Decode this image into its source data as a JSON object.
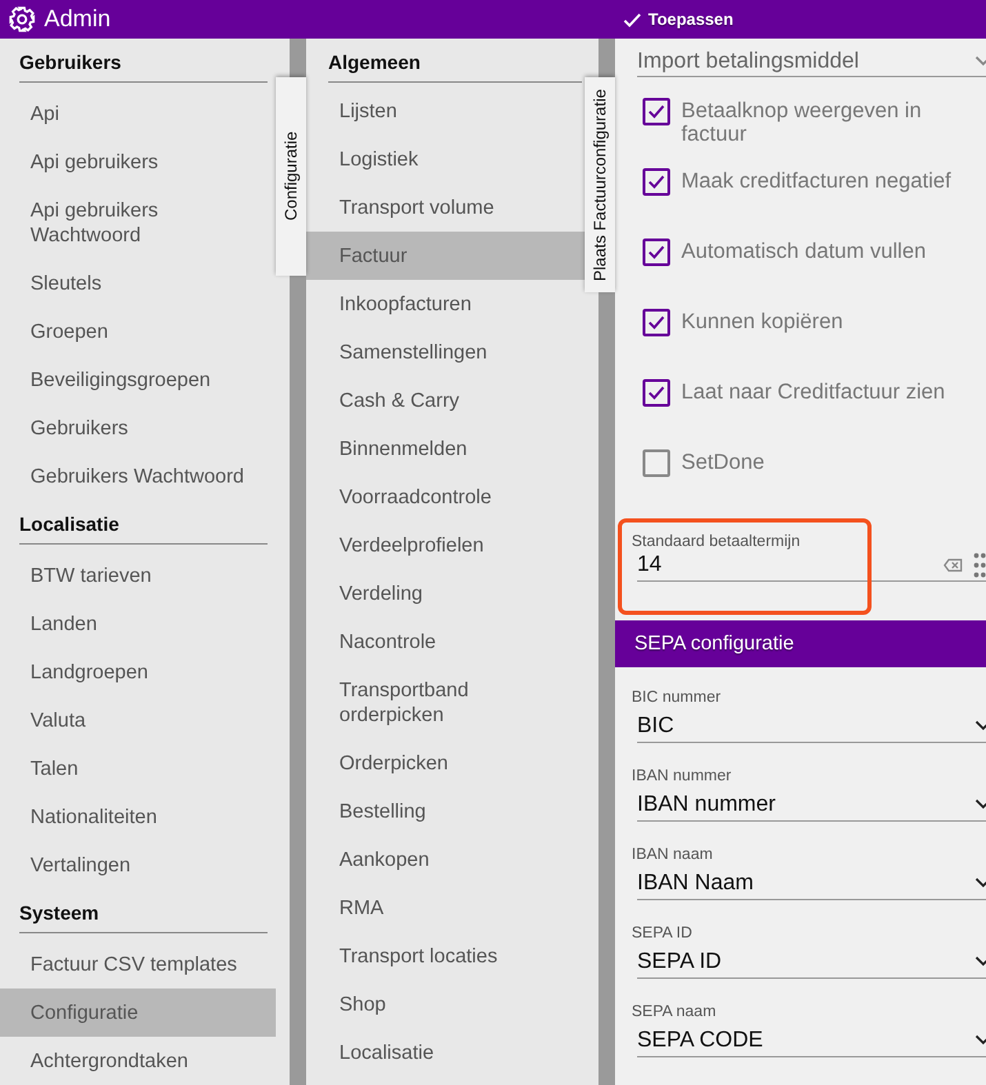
{
  "header": {
    "title": "Admin",
    "apply_button": "Toepassen"
  },
  "menu": {
    "side_tab": "Configuratie",
    "sections": [
      {
        "title": "Gebruikers",
        "items": [
          {
            "label": "Api",
            "selected": false
          },
          {
            "label": "Api gebruikers",
            "selected": false
          },
          {
            "label": "Api gebruikers Wachtwoord",
            "selected": false
          },
          {
            "label": "Sleutels",
            "selected": false
          },
          {
            "label": "Groepen",
            "selected": false
          },
          {
            "label": "Beveiligingsgroepen",
            "selected": false
          },
          {
            "label": "Gebruikers",
            "selected": false
          },
          {
            "label": "Gebruikers Wachtwoord",
            "selected": false
          }
        ]
      },
      {
        "title": "Localisatie",
        "items": [
          {
            "label": "BTW tarieven",
            "selected": false
          },
          {
            "label": "Landen",
            "selected": false
          },
          {
            "label": "Landgroepen",
            "selected": false
          },
          {
            "label": "Valuta",
            "selected": false
          },
          {
            "label": "Talen",
            "selected": false
          },
          {
            "label": "Nationaliteiten",
            "selected": false
          },
          {
            "label": "Vertalingen",
            "selected": false
          }
        ]
      },
      {
        "title": "Systeem",
        "items": [
          {
            "label": "Factuur CSV templates",
            "selected": false
          },
          {
            "label": "Configuratie",
            "selected": true
          },
          {
            "label": "Achtergrondtaken",
            "selected": false
          }
        ]
      }
    ]
  },
  "submenu": {
    "side_tab": "Plaats Factuurconfiguratie",
    "sections": [
      {
        "title": "Algemeen",
        "items": [
          {
            "label": "Lijsten",
            "selected": false
          },
          {
            "label": "Logistiek",
            "selected": false
          },
          {
            "label": "Transport volume",
            "selected": false
          },
          {
            "label": "Factuur",
            "selected": true
          },
          {
            "label": "Inkoopfacturen",
            "selected": false
          },
          {
            "label": "Samenstellingen",
            "selected": false
          },
          {
            "label": "Cash & Carry",
            "selected": false
          },
          {
            "label": "Binnenmelden",
            "selected": false
          },
          {
            "label": "Voorraadcontrole",
            "selected": false
          },
          {
            "label": "Verdeelprofielen",
            "selected": false
          },
          {
            "label": "Verdeling",
            "selected": false
          },
          {
            "label": "Nacontrole",
            "selected": false
          },
          {
            "label": "Transportband orderpicken",
            "selected": false
          },
          {
            "label": "Orderpicken",
            "selected": false
          },
          {
            "label": "Bestelling",
            "selected": false
          },
          {
            "label": "Aankopen",
            "selected": false
          },
          {
            "label": "RMA",
            "selected": false
          },
          {
            "label": "Transport locaties",
            "selected": false
          },
          {
            "label": "Shop",
            "selected": false
          },
          {
            "label": "Localisatie",
            "selected": false
          }
        ]
      }
    ]
  },
  "form": {
    "fields": [
      {
        "kind": "select",
        "value": "Import betalingsmiddel"
      },
      {
        "kind": "checkbox",
        "label": "Betaalknop weergeven in factuur",
        "checked": true
      },
      {
        "kind": "checkbox",
        "label": "Maak creditfacturen negatief",
        "checked": true
      },
      {
        "kind": "checkbox",
        "label": "Automatisch datum vullen",
        "checked": true
      },
      {
        "kind": "checkbox",
        "label": "Kunnen kopiëren",
        "checked": true
      },
      {
        "kind": "checkbox",
        "label": "Laat naar Creditfactuur zien",
        "checked": true
      },
      {
        "kind": "checkbox",
        "label": "SetDone",
        "checked": false
      },
      {
        "kind": "number",
        "label": "Standaard betaaltermijn",
        "value": "14",
        "highlighted": true
      }
    ],
    "sepa": {
      "title": "SEPA configuratie",
      "fields": [
        {
          "label": "BIC nummer",
          "value": "BIC"
        },
        {
          "label": "IBAN nummer",
          "value": "IBAN nummer"
        },
        {
          "label": "IBAN naam",
          "value": "IBAN Naam"
        },
        {
          "label": "SEPA ID",
          "value": "SEPA ID"
        },
        {
          "label": "SEPA naam",
          "value": "SEPA CODE"
        }
      ]
    }
  }
}
